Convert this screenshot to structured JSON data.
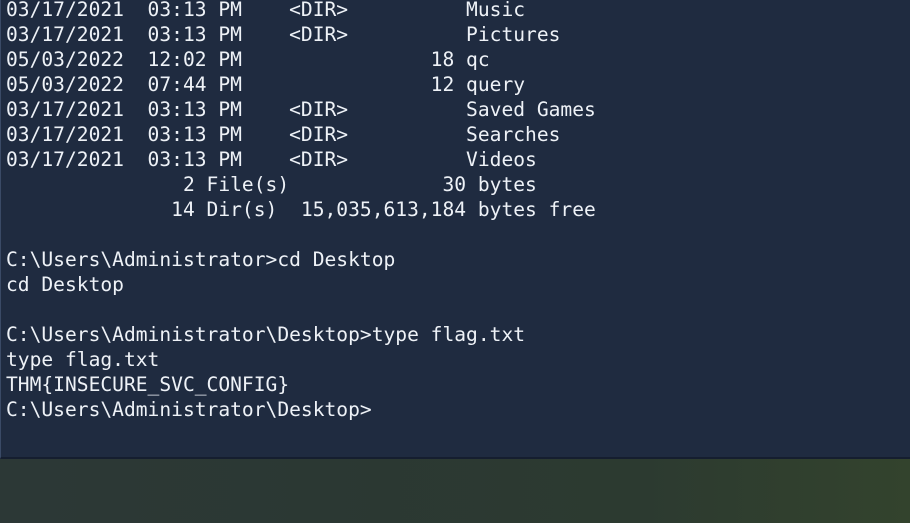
{
  "terminal": {
    "lines": [
      "03/17/2021  03:13 PM    <DIR>          Music",
      "03/17/2021  03:13 PM    <DIR>          Pictures",
      "05/03/2022  12:02 PM                18 qc",
      "05/03/2022  07:44 PM                12 query",
      "03/17/2021  03:13 PM    <DIR>          Saved Games",
      "03/17/2021  03:13 PM    <DIR>          Searches",
      "03/17/2021  03:13 PM    <DIR>          Videos",
      "               2 File(s)             30 bytes",
      "              14 Dir(s)  15,035,613,184 bytes free",
      "",
      "C:\\Users\\Administrator>cd Desktop",
      "cd Desktop",
      "",
      "C:\\Users\\Administrator\\Desktop>type flag.txt",
      "type flag.txt",
      "THM{INSECURE_SVC_CONFIG}",
      "C:\\Users\\Administrator\\Desktop>"
    ]
  },
  "colors": {
    "terminal_background": "#1f2b40",
    "terminal_text": "#eef2f7",
    "desktop_background": "#2b3833"
  }
}
